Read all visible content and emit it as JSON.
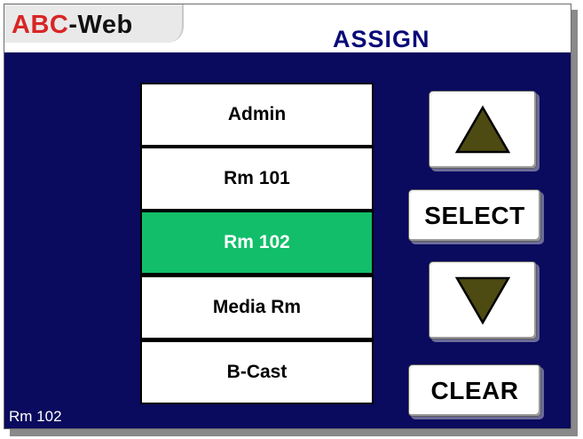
{
  "header": {
    "logo_part1": "ABC",
    "logo_part2": "-Web",
    "title": "ASSIGN"
  },
  "list": {
    "items": [
      {
        "label": "Admin",
        "selected": false
      },
      {
        "label": "Rm 101",
        "selected": false
      },
      {
        "label": "Rm 102",
        "selected": true
      },
      {
        "label": "Media Rm",
        "selected": false
      },
      {
        "label": "B-Cast",
        "selected": false
      }
    ]
  },
  "controls": {
    "up_icon": "triangle-up-icon",
    "down_icon": "triangle-down-icon",
    "select_label": "SELECT",
    "clear_label": "CLEAR"
  },
  "status": {
    "current": "Rm 102"
  },
  "colors": {
    "background": "#0a0a5e",
    "selected": "#12be6a",
    "logo_red": "#d92525",
    "title": "#0a0a78",
    "arrow_fill": "#4d4a12"
  }
}
